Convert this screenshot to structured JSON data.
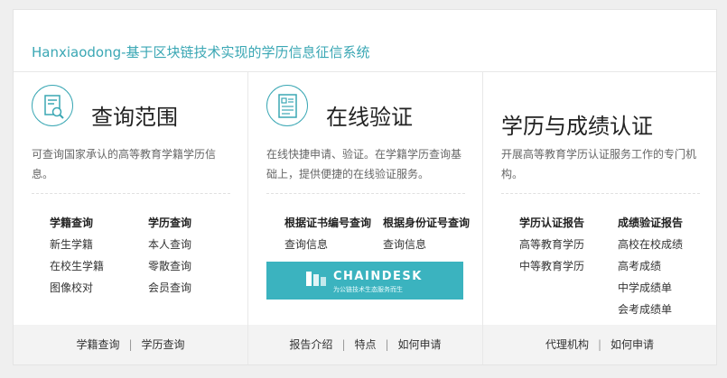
{
  "header": {
    "title": "Hanxiaodong-基于区块链技术实现的学历信息征信系统"
  },
  "colors": {
    "accent": "#3aa7b4",
    "banner": "#3bb3bf"
  },
  "col1": {
    "icon": "document-search-icon",
    "title": "查询范围",
    "desc": "可查询国家承认的高等教育学籍学历信息。",
    "groups": [
      {
        "heading": "学籍查询",
        "items": [
          "新生学籍",
          "在校生学籍",
          "图像校对"
        ]
      },
      {
        "heading": "学历查询",
        "items": [
          "本人查询",
          "零散查询",
          "会员查询"
        ]
      }
    ],
    "footer": [
      "学籍查询",
      "学历查询"
    ]
  },
  "col2": {
    "icon": "document-verify-icon",
    "title": "在线验证",
    "desc": "在线快捷申请、验证。在学籍学历查询基础上，提供便捷的在线验证服务。",
    "groups": [
      {
        "heading": "根据证书编号查询",
        "items": [
          "查询信息"
        ]
      },
      {
        "heading": "根据身份证号查询",
        "items": [
          "查询信息"
        ]
      }
    ],
    "banner": {
      "brand": "CHAINDESK",
      "slogan": "为公链技术生态服务而生"
    },
    "footer": [
      "报告介绍",
      "特点",
      "如何申请"
    ]
  },
  "col3": {
    "title": "学历与成绩认证",
    "desc": "开展高等教育学历认证服务工作的专门机构。",
    "groups": [
      {
        "heading": "学历认证报告",
        "items": [
          "高等教育学历",
          "中等教育学历"
        ]
      },
      {
        "heading": "成绩验证报告",
        "items": [
          "高校在校成绩",
          "高考成绩",
          "中学成绩单",
          "会考成绩单"
        ]
      }
    ],
    "footer": [
      "代理机构",
      "如何申请"
    ]
  }
}
